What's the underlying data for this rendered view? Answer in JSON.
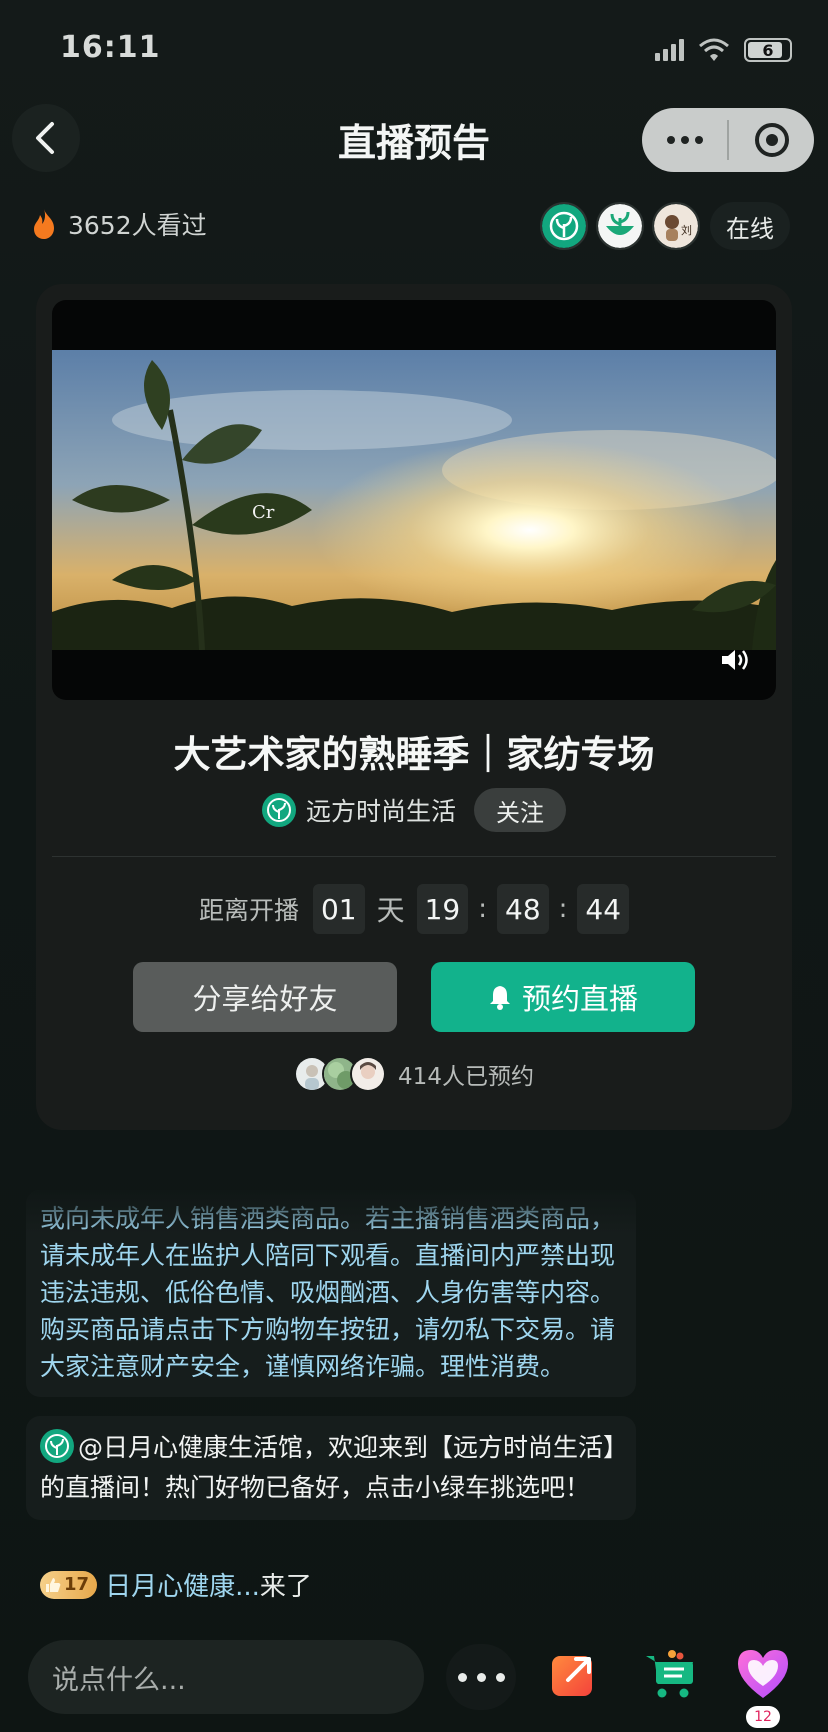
{
  "status_bar": {
    "time": "16:11",
    "battery": "6"
  },
  "header": {
    "title": "直播预告",
    "back_icon": "chevron-left-icon",
    "more_icon": "more-dots-icon",
    "close_icon": "target-icon"
  },
  "stats": {
    "views": "3652人看过",
    "online_label": "在线"
  },
  "card": {
    "title": "大艺术家的熟睡季｜家纺专场",
    "host_name": "远方时尚生活",
    "follow_label": "关注",
    "video_overlay_text": "Cr",
    "countdown": {
      "label": "距离开播",
      "days": "01",
      "day_unit": "天",
      "hours": "19",
      "minutes": "48",
      "seconds": "44",
      "separator": ":"
    },
    "share_label": "分享给好友",
    "reserve_label": "预约直播",
    "reserved_count": "414人已预约"
  },
  "chat": {
    "notice": "或向未成年人销售酒类商品。若主播销售酒类商品，请未成年人在监护人陪同下观看。直播间内严禁出现违法违规、低俗色情、吸烟酗酒、人身伤害等内容。购买商品请点击下方购物车按钮，请勿私下交易。请大家注意财产安全，谨慎网络诈骗。理性消费。",
    "welcome": "@日月心健康生活馆，欢迎来到【远方时尚生活】的直播间！热门好物已备好，点击小绿车挑选吧！",
    "join_level": "17",
    "join_name": "日月心健康...",
    "join_action": "来了"
  },
  "bottom": {
    "input_placeholder": "说点什么...",
    "like_count": "12"
  },
  "colors": {
    "accent": "#12b28c",
    "chat_name": "#9fd6ef",
    "background": "#101716"
  }
}
